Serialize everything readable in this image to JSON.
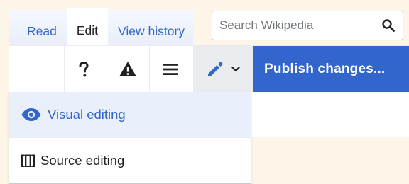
{
  "tabs": [
    {
      "label": "Read",
      "active": false
    },
    {
      "label": "Edit",
      "active": true
    },
    {
      "label": "View history",
      "active": false
    }
  ],
  "search": {
    "placeholder": "Search Wikipedia",
    "icon": "search-icon"
  },
  "toolbar": {
    "help_icon": "help-icon",
    "notices_icon": "warning-icon",
    "menu_icon": "menu-icon",
    "edit_mode_icon": "pencil-icon",
    "edit_mode_dropdown_icon": "chevron-down-icon",
    "publish_label": "Publish changes..."
  },
  "edit_mode_menu": {
    "items": [
      {
        "label": "Visual editing",
        "icon": "eye-icon",
        "selected": true
      },
      {
        "label": "Source editing",
        "icon": "brackets-icon",
        "selected": false,
        "icon_text": "[[]]"
      }
    ]
  },
  "colors": {
    "accent": "#3366cc",
    "background": "#fdf5e8",
    "selected_item_bg": "#eaf0fb"
  }
}
